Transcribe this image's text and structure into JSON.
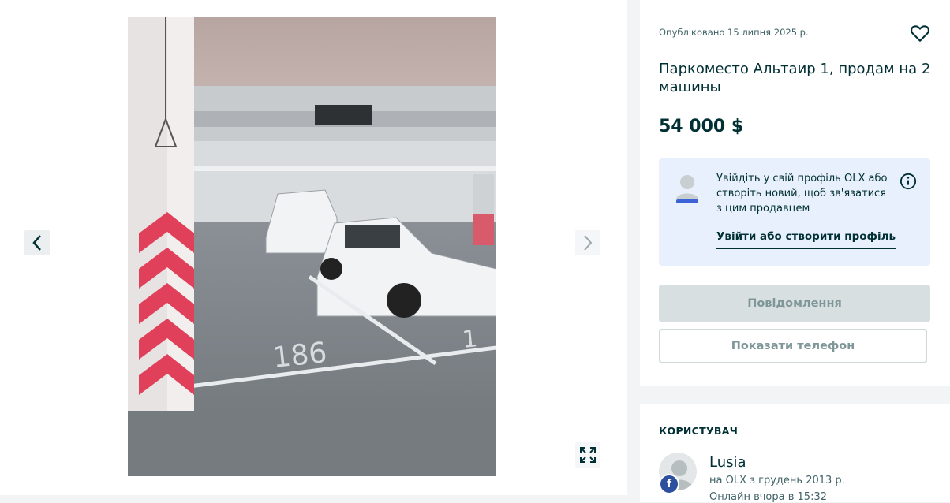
{
  "listing": {
    "published": "Опубліковано 15 липня 2025 р.",
    "title": "Паркоместо Альтаир 1, продам на 2 машины",
    "price": "54 000 $"
  },
  "login_prompt": {
    "text": "Увійдіть у свій профіль OLX або створіть новий, щоб зв'язатися з цим продавцем",
    "link_label": "Увійти або створити профіль"
  },
  "actions": {
    "message_label": "Повідомлення",
    "phone_label": "Показати телефон"
  },
  "user": {
    "heading": "КОРИСТУВАЧ",
    "name": "Lusia",
    "member_since": "на OLX з грудень 2013 р.",
    "online": "Онлайн вчора в 15:32",
    "badge_icon": "facebook-icon"
  },
  "photo": {
    "stall_number": "186",
    "stall_number_partial": "1"
  },
  "icons": {
    "prev": "chevron-left-icon",
    "next": "chevron-right-icon",
    "expand": "expand-icon",
    "favorite": "heart-icon",
    "info": "info-icon",
    "login_avatar": "user-placeholder-icon"
  },
  "colors": {
    "text_primary": "#002f34",
    "login_box_bg": "#e8f0fd",
    "button_disabled_bg": "#d8dfe0",
    "button_text_muted": "#7f9799",
    "facebook_blue": "#2c4f9e"
  }
}
